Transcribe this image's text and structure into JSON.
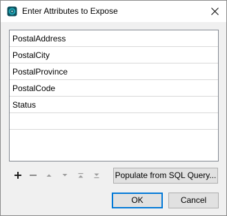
{
  "window": {
    "title": "Enter Attributes to Expose",
    "app_icon": "app-icon",
    "close_icon": "close-icon"
  },
  "attributes": [
    {
      "label": "PostalAddress"
    },
    {
      "label": "PostalCity"
    },
    {
      "label": "PostalProvince"
    },
    {
      "label": "PostalCode"
    },
    {
      "label": "Status"
    },
    {
      "label": ""
    }
  ],
  "toolbar": {
    "add_icon": "plus-icon",
    "remove_icon": "minus-icon",
    "move_up_icon": "arrow-up-icon",
    "move_down_icon": "arrow-down-icon",
    "move_top_icon": "move-to-top-icon",
    "move_bottom_icon": "move-to-bottom-icon",
    "populate_label": "Populate from SQL Query..."
  },
  "buttons": {
    "ok_label": "OK",
    "cancel_label": "Cancel"
  },
  "colors": {
    "accent": "#0078d7",
    "icon_teal": "#1fa3b3"
  }
}
